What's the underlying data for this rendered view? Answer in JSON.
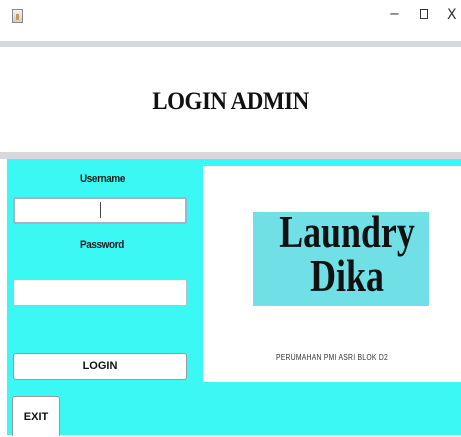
{
  "window": {
    "title": "",
    "minimize_glyph": "−",
    "close_glyph": "X"
  },
  "header": {
    "title": "LOGIN ADMIN"
  },
  "form": {
    "username_label": "Username",
    "username_value": "",
    "password_label": "Password",
    "password_value": "",
    "login_button": "LOGIN",
    "exit_button": "EXIT"
  },
  "logo": {
    "line1": "Laundry",
    "line2": "Dika",
    "address": "PERUMAHAN PMI ASRI BLOK D2"
  },
  "colors": {
    "panel_background": "#3cf8f4",
    "logo_band": "#70dfe6",
    "divider": "#d6d8dc"
  }
}
